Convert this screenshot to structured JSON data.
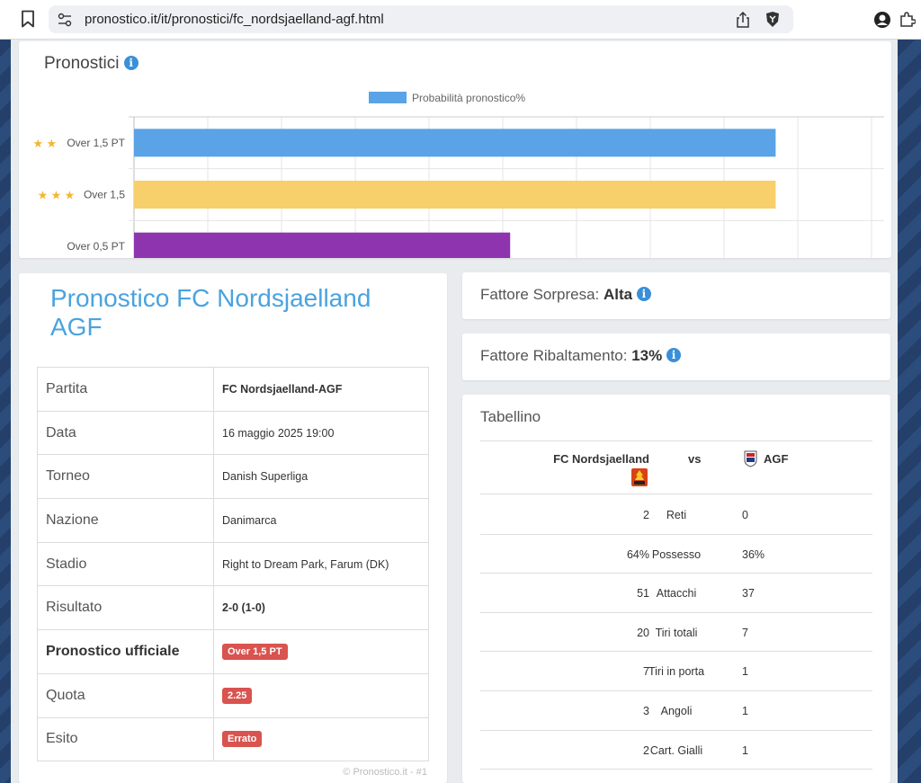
{
  "browser": {
    "url": "pronostico.it/it/pronostici/fc_nordsjaelland-agf.html"
  },
  "chart_panel": {
    "title": "Pronostici"
  },
  "chart_data": {
    "type": "bar",
    "orientation": "horizontal",
    "legend": [
      "Probabilità pronostico%"
    ],
    "legend_position": "top",
    "categories": [
      "Over 1,5 PT",
      "Over 1,5",
      "Over 0,5 PT"
    ],
    "category_stars": [
      2,
      3,
      0
    ],
    "series": [
      {
        "name": "Probabilità pronostico%",
        "values": [
          87,
          87,
          51
        ]
      }
    ],
    "bar_colors": [
      "#5aa3e6",
      "#f7cf6b",
      "#8e34ae"
    ],
    "xlim": [
      0,
      100
    ],
    "xticks": [
      "0",
      "10",
      "20",
      "30",
      "40",
      "50",
      "60",
      "70",
      "80",
      "90",
      "100"
    ],
    "grid": true
  },
  "match": {
    "title": "Pronostico FC Nordsjaelland AGF",
    "rows": [
      {
        "label": "Partita",
        "value": "FC Nordsjaelland-AGF",
        "style": "bold"
      },
      {
        "label": "Data",
        "value": "16 maggio 2025 19:00",
        "style": "plain"
      },
      {
        "label": "Torneo",
        "value": "Danish Superliga",
        "style": "plain"
      },
      {
        "label": "Nazione",
        "value": "Danimarca",
        "style": "plain"
      },
      {
        "label": "Stadio",
        "value": "Right to Dream Park, Farum (DK)",
        "style": "plain"
      },
      {
        "label": "Risultato",
        "value": "2-0 (1-0)",
        "style": "bold"
      },
      {
        "label": "Pronostico ufficiale",
        "value": "Over 1,5 PT",
        "style": "badge"
      },
      {
        "label": "Quota",
        "value": "2.25",
        "style": "badge"
      },
      {
        "label": "Esito",
        "value": "Errato",
        "style": "badge"
      }
    ],
    "copyright": "© Pronostico.it - #1"
  },
  "factors": {
    "sorpresa_label": "Fattore Sorpresa:",
    "sorpresa_value": "Alta",
    "ribaltamento_label": "Fattore Ribaltamento:",
    "ribaltamento_value": "13%"
  },
  "tabellino": {
    "title": "Tabellino",
    "home": "FC Nordsjaelland",
    "vs": "vs",
    "away": "AGF",
    "stats": [
      {
        "home": "2",
        "label": "Reti",
        "away": "0"
      },
      {
        "home": "64%",
        "label": "Possesso",
        "away": "36%"
      },
      {
        "home": "51",
        "label": "Attacchi",
        "away": "37"
      },
      {
        "home": "20",
        "label": "Tiri totali",
        "away": "7"
      },
      {
        "home": "7",
        "label": "Tiri in porta",
        "away": "1"
      },
      {
        "home": "3",
        "label": "Angoli",
        "away": "1"
      },
      {
        "home": "2",
        "label": "Cart. Gialli",
        "away": "1"
      }
    ]
  }
}
